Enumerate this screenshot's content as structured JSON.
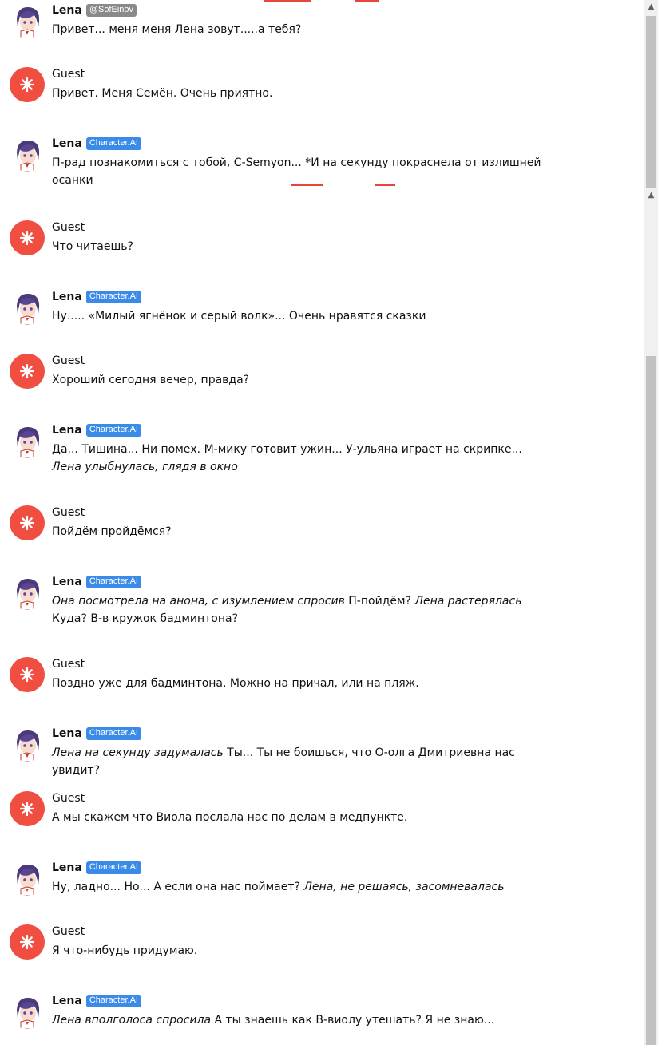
{
  "colors": {
    "guest_avatar": "#f04e41",
    "badge_bot": "#3a8be8",
    "badge_creator": "#8a8a8a",
    "accent_red": "#e8453c"
  },
  "top_pane": {
    "messages": [
      {
        "author": "Lena",
        "badge": "@SofEinov",
        "text": "Привет... меня меня Лена зовут.....а тебя?"
      },
      {
        "author": "Guest",
        "text": "Привет. Меня Семён. Очень приятно."
      },
      {
        "author": "Lena",
        "badge": "Character.AI",
        "text": "П-рад познакомиться с тобой, С-Semyon... *И на секунду покраснела от излишней осанки"
      }
    ]
  },
  "main_pane": {
    "messages": [
      {
        "author": "Guest",
        "text": "Что читаешь?"
      },
      {
        "author": "Lena",
        "badge": "Character.AI",
        "text": "Ну..... «Милый ягнёнок и серый волк»... Очень нравятся сказки"
      },
      {
        "author": "Guest",
        "text": "Хороший сегодня вечер, правда?"
      },
      {
        "author": "Lena",
        "badge": "Character.AI",
        "text_plain": "Да... Тишина... Ни помех. М-мику готовит ужин... У-ульяна играет на скрипке... ",
        "text_italic": "Лена улыбнулась, глядя в окно"
      },
      {
        "author": "Guest",
        "text": "Пойдём пройдёмся?"
      },
      {
        "author": "Lena",
        "badge": "Character.AI",
        "text_italic": "Она посмотрела на анона, с изумлением спросив",
        "text_plain": " П-пойдём? ",
        "text_italic2": "Лена растерялась",
        "text_plain2": " Куда? В-в кружок бадминтона?"
      },
      {
        "author": "Guest",
        "text": "Поздно уже для бадминтона. Можно на причал, или на пляж."
      },
      {
        "author": "Lena",
        "badge": "Character.AI",
        "text_italic": "Лена на секунду задумалась",
        "text_plain": " Ты... Ты не боишься, что О-олга Дмитриевна нас увидит?"
      },
      {
        "author": "Guest",
        "text": "А мы скажем что Виола послала нас по делам в медпункте."
      },
      {
        "author": "Lena",
        "badge": "Character.AI",
        "text_plain": "Ну, ладно... Но... А если она нас поймает? ",
        "text_italic": "Лена, не решаясь, засомневалась"
      },
      {
        "author": "Guest",
        "text": "Я что-нибудь придумаю."
      },
      {
        "author": "Lena",
        "badge": "Character.AI",
        "text_italic": "Лена вполголоса спросила",
        "text_plain": " А ты знаешь как В-виолу утешать? Я не знаю..."
      }
    ]
  }
}
